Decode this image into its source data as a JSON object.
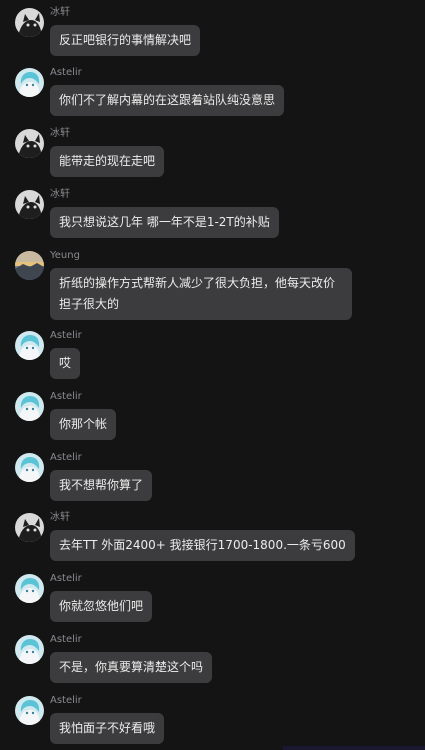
{
  "messages": [
    {
      "sender": "冰轩",
      "avatar": "cat-avatar-icon",
      "text": "反正吧银行的事情解决吧"
    },
    {
      "sender": "Astelir",
      "avatar": "anime-avatar-icon",
      "text": "你们不了解内幕的在这跟着站队纯没意思"
    },
    {
      "sender": "冰轩",
      "avatar": "cat-avatar-icon",
      "text": "能带走的现在走吧"
    },
    {
      "sender": "冰轩",
      "avatar": "cat-avatar-icon",
      "text": "我只想说这几年 哪一年不是1-2T的补贴"
    },
    {
      "sender": "Yeung",
      "avatar": "landscape-avatar-icon",
      "text": "折纸的操作方式帮新人减少了很大负担，他每天改价担子很大的"
    },
    {
      "sender": "Astelir",
      "avatar": "anime-avatar-icon",
      "text": "哎"
    },
    {
      "sender": "Astelir",
      "avatar": "anime-avatar-icon",
      "text": "你那个帐"
    },
    {
      "sender": "Astelir",
      "avatar": "anime-avatar-icon",
      "text": "我不想帮你算了"
    },
    {
      "sender": "冰轩",
      "avatar": "cat-avatar-icon",
      "text": "去年TT 外面2400+ 我接银行1700-1800.一条亏600"
    },
    {
      "sender": "Astelir",
      "avatar": "anime-avatar-icon",
      "text": "你就忽悠他们吧"
    },
    {
      "sender": "Astelir",
      "avatar": "anime-avatar-icon",
      "text": "不是，你真要算清楚这个吗"
    },
    {
      "sender": "Astelir",
      "avatar": "anime-avatar-icon",
      "text": "我怕面子不好看哦"
    }
  ],
  "colors": {
    "background": "#141415",
    "bubble": "#3c3c3e",
    "text": "#ececec",
    "sender": "#8b8b90"
  }
}
